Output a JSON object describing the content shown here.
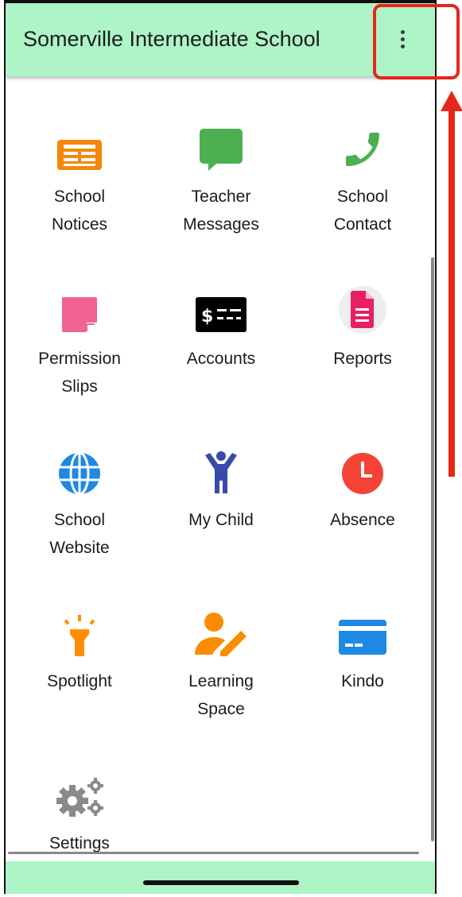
{
  "app": {
    "title": "Somerville Intermediate School",
    "menu_icon": "more-vert-icon"
  },
  "tiles": [
    {
      "label": "School Notices",
      "icon": "newspaper-icon",
      "color": "#f5870a"
    },
    {
      "label": "Teacher Messages",
      "icon": "chat-bubble-icon",
      "color": "#4caf50"
    },
    {
      "label": "School Contact",
      "icon": "phone-icon",
      "color": "#4caf50"
    },
    {
      "label": "Permission Slips",
      "icon": "sticky-note-icon",
      "color": "#f06292"
    },
    {
      "label": "Accounts",
      "icon": "money-bill-icon",
      "color": "#000000"
    },
    {
      "label": "Reports",
      "icon": "document-icon",
      "color": "#e91e63"
    },
    {
      "label": "School Website",
      "icon": "globe-icon",
      "color": "#1e88e5"
    },
    {
      "label": "My Child",
      "icon": "child-icon",
      "color": "#3949ab"
    },
    {
      "label": "Absence",
      "icon": "clock-icon",
      "color": "#f44336"
    },
    {
      "label": "Spotlight",
      "icon": "flashlight-icon",
      "color": "#ff8f00"
    },
    {
      "label": "Learning Space",
      "icon": "person-edit-icon",
      "color": "#fb8c00"
    },
    {
      "label": "Kindo",
      "icon": "credit-card-icon",
      "color": "#1e88e5"
    },
    {
      "label": "Settings",
      "icon": "gears-icon",
      "color": "#8a8a8a"
    }
  ],
  "theme": {
    "appbar_color": "#adf4c7",
    "highlight_color": "#e52719"
  }
}
